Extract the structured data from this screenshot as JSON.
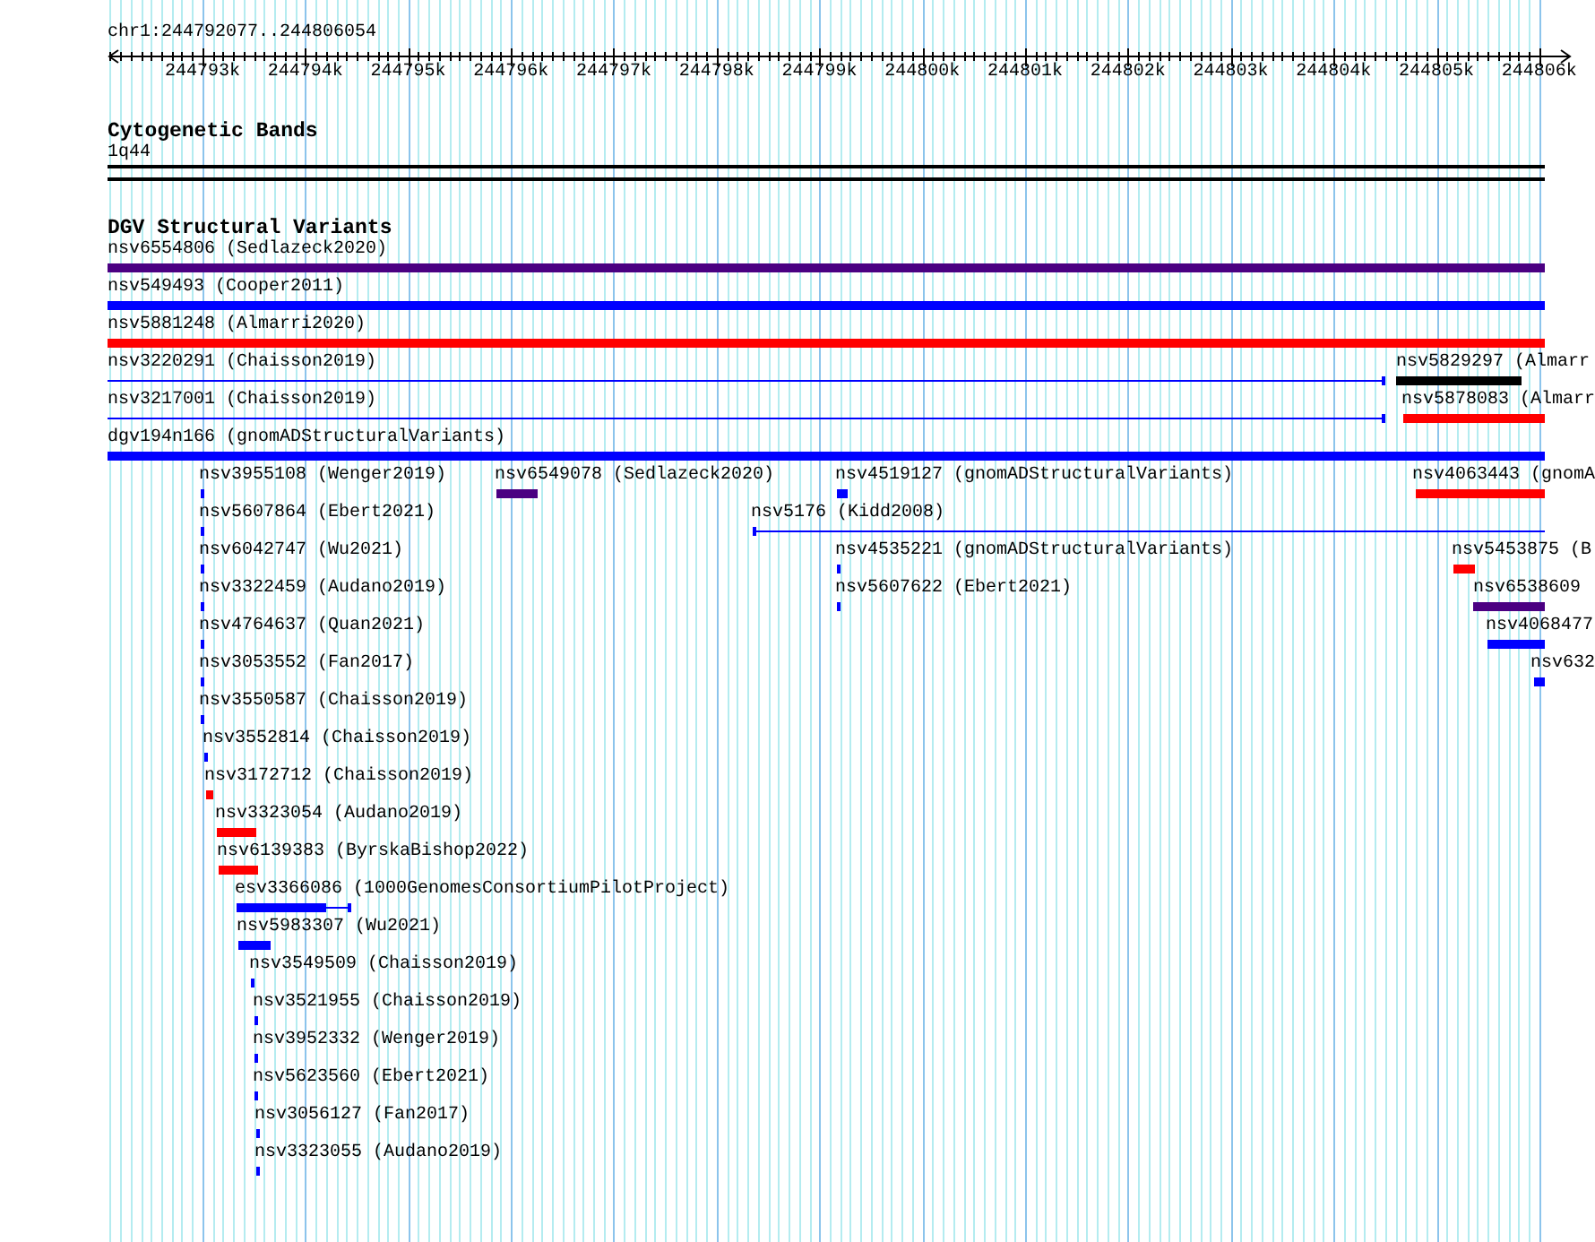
{
  "ruler": {
    "region": "chr1:244792077..244806054",
    "ticks": [
      "244793k",
      "244794k",
      "244795k",
      "244796k",
      "244797k",
      "244798k",
      "244799k",
      "244800k",
      "244801k",
      "244802k",
      "244803k",
      "244804k",
      "244805k",
      "244806k"
    ]
  },
  "tracks": [
    {
      "title": "Cytogenetic Bands",
      "features": [
        {
          "label": "1q44",
          "kind": "band"
        }
      ]
    },
    {
      "title": "DGV Structural Variants",
      "features": [
        {
          "label": "nsv6554806 (Sedlazeck2020)",
          "kind": "bar",
          "color": "#4b0082"
        },
        {
          "label": "nsv549493 (Cooper2011)",
          "kind": "bar",
          "color": "#0000ff"
        },
        {
          "label": "nsv5881248 (Almarri2020)",
          "kind": "bar",
          "color": "#ff0000"
        },
        {
          "label": "nsv3220291 (Chaisson2019)",
          "kind": "line-end",
          "color": "#0000ff"
        },
        {
          "label": "nsv5829297 (Almarr",
          "kind": "bar",
          "color": "#000000"
        },
        {
          "label": "nsv3217001 (Chaisson2019)",
          "kind": "line-end",
          "color": "#0000ff"
        },
        {
          "label": "nsv5878083 (Almarr",
          "kind": "bar",
          "color": "#ff0000"
        },
        {
          "label": "dgv194n166 (gnomADStructuralVariants)",
          "kind": "bar",
          "color": "#0000ff"
        },
        {
          "label": "nsv3955108 (Wenger2019)",
          "kind": "bar",
          "color": "#0000ff"
        },
        {
          "label": "nsv6549078 (Sedlazeck2020)",
          "kind": "bar",
          "color": "#4b0082"
        },
        {
          "label": "nsv4519127 (gnomADStructuralVariants)",
          "kind": "bar",
          "color": "#0000ff"
        },
        {
          "label": "nsv4063443 (gnomA",
          "kind": "bar",
          "color": "#ff0000"
        },
        {
          "label": "nsv5607864 (Ebert2021)",
          "kind": "bar",
          "color": "#0000ff"
        },
        {
          "label": "nsv5176 (Kidd2008)",
          "kind": "line-start",
          "color": "#0000ff"
        },
        {
          "label": "nsv6042747 (Wu2021)",
          "kind": "bar",
          "color": "#0000ff"
        },
        {
          "label": "nsv4535221 (gnomADStructuralVariants)",
          "kind": "bar",
          "color": "#0000ff"
        },
        {
          "label": "nsv5453875 (B",
          "kind": "bar",
          "color": "#ff0000"
        },
        {
          "label": "nsv3322459 (Audano2019)",
          "kind": "bar",
          "color": "#0000ff"
        },
        {
          "label": "nsv5607622 (Ebert2021)",
          "kind": "bar",
          "color": "#0000ff"
        },
        {
          "label": "nsv6538609",
          "kind": "bar",
          "color": "#4b0082"
        },
        {
          "label": "nsv4764637 (Quan2021)",
          "kind": "bar",
          "color": "#0000ff"
        },
        {
          "label": "nsv4068477",
          "kind": "bar",
          "color": "#0000ff"
        },
        {
          "label": "nsv3053552 (Fan2017)",
          "kind": "bar",
          "color": "#0000ff"
        },
        {
          "label": "nsv632",
          "kind": "bar",
          "color": "#0000ff"
        },
        {
          "label": "nsv3550587 (Chaisson2019)",
          "kind": "bar",
          "color": "#0000ff"
        },
        {
          "label": "nsv3552814 (Chaisson2019)",
          "kind": "bar",
          "color": "#0000ff"
        },
        {
          "label": "nsv3172712 (Chaisson2019)",
          "kind": "bar",
          "color": "#ff0000"
        },
        {
          "label": "nsv3323054 (Audano2019)",
          "kind": "bar",
          "color": "#ff0000"
        },
        {
          "label": "nsv6139383 (ByrskaBishop2022)",
          "kind": "bar",
          "color": "#ff0000"
        },
        {
          "label": "esv3366086 (1000GenomesConsortiumPilotProject)",
          "kind": "bar-tail",
          "color": "#0000ff"
        },
        {
          "label": "nsv5983307 (Wu2021)",
          "kind": "bar",
          "color": "#0000ff"
        },
        {
          "label": "nsv3549509 (Chaisson2019)",
          "kind": "bar",
          "color": "#0000ff"
        },
        {
          "label": "nsv3521955 (Chaisson2019)",
          "kind": "bar",
          "color": "#0000ff"
        },
        {
          "label": "nsv3952332 (Wenger2019)",
          "kind": "bar",
          "color": "#0000ff"
        },
        {
          "label": "nsv5623560 (Ebert2021)",
          "kind": "bar",
          "color": "#0000ff"
        },
        {
          "label": "nsv3056127 (Fan2017)",
          "kind": "bar",
          "color": "#0000ff"
        },
        {
          "label": "nsv3323055 (Audano2019)",
          "kind": "bar",
          "color": "#0000ff"
        }
      ]
    }
  ]
}
